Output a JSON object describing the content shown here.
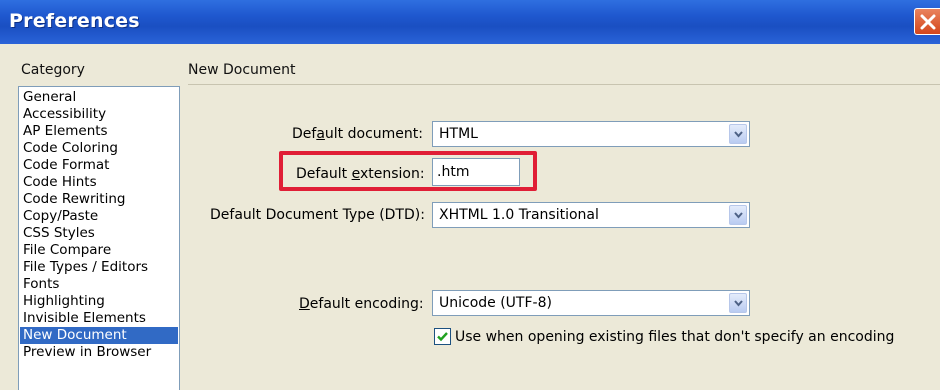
{
  "window": {
    "title": "Preferences",
    "close_icon": "close-x-icon"
  },
  "category": {
    "heading": "Category",
    "selected": "New Document",
    "items": [
      "General",
      "Accessibility",
      "AP Elements",
      "Code Coloring",
      "Code Format",
      "Code Hints",
      "Code Rewriting",
      "Copy/Paste",
      "CSS Styles",
      "File Compare",
      "File Types / Editors",
      "Fonts",
      "Highlighting",
      "Invisible Elements",
      "New Document",
      "Preview in Browser"
    ]
  },
  "panel": {
    "heading": "New Document",
    "default_document": {
      "label_pre": "Def",
      "label_accel": "a",
      "label_post": "ult document:",
      "value": "HTML"
    },
    "default_extension": {
      "label_pre": "Default ",
      "label_accel": "e",
      "label_post": "xtension:",
      "value": ".htm"
    },
    "default_dtd": {
      "label": "Default Document Type (DTD):",
      "value": "XHTML 1.0 Transitional"
    },
    "default_encoding": {
      "label_pre": "",
      "label_accel": "D",
      "label_post": "efault encoding:",
      "value": "Unicode (UTF-8)"
    },
    "use_existing": {
      "checked": true,
      "label": "Use when opening existing files that don't specify an encoding"
    }
  },
  "colors": {
    "titlebar": "#1f58cf",
    "selection": "#316ac5",
    "highlight_box": "#e01e36",
    "dialog_bg": "#ece9d8"
  }
}
